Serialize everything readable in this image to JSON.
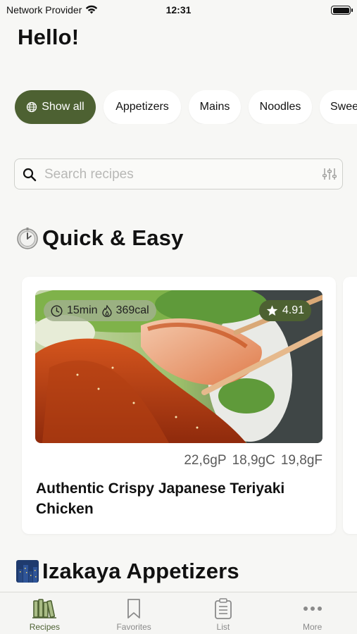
{
  "status_bar": {
    "carrier": "Network Provider",
    "time": "12:31"
  },
  "greeting": "Hello!",
  "categories": [
    {
      "label": "Show all",
      "active": true
    },
    {
      "label": "Appetizers"
    },
    {
      "label": "Mains"
    },
    {
      "label": "Noodles"
    },
    {
      "label": "Swee"
    }
  ],
  "search": {
    "placeholder": "Search recipes",
    "value": ""
  },
  "sections": [
    {
      "title": "Quick & Easy",
      "icon": "timer-emoji"
    },
    {
      "title": "Izakaya Appetizers",
      "icon": "night-city-emoji"
    }
  ],
  "recipe_card": {
    "time": "15min",
    "calories": "369cal",
    "rating": "4.91",
    "protein": "22,6gP",
    "carbs": "18,9gC",
    "fat": "19,8gF",
    "title": "Authentic Crispy Japanese Teriyaki Chicken"
  },
  "tabs": [
    {
      "label": "Recipes",
      "icon": "books-icon",
      "active": true
    },
    {
      "label": "Favorites",
      "icon": "bookmark-icon"
    },
    {
      "label": "List",
      "icon": "clipboard-icon"
    },
    {
      "label": "More",
      "icon": "ellipsis-icon"
    }
  ],
  "colors": {
    "accent": "#4d6132",
    "background": "#f7f7f5"
  }
}
